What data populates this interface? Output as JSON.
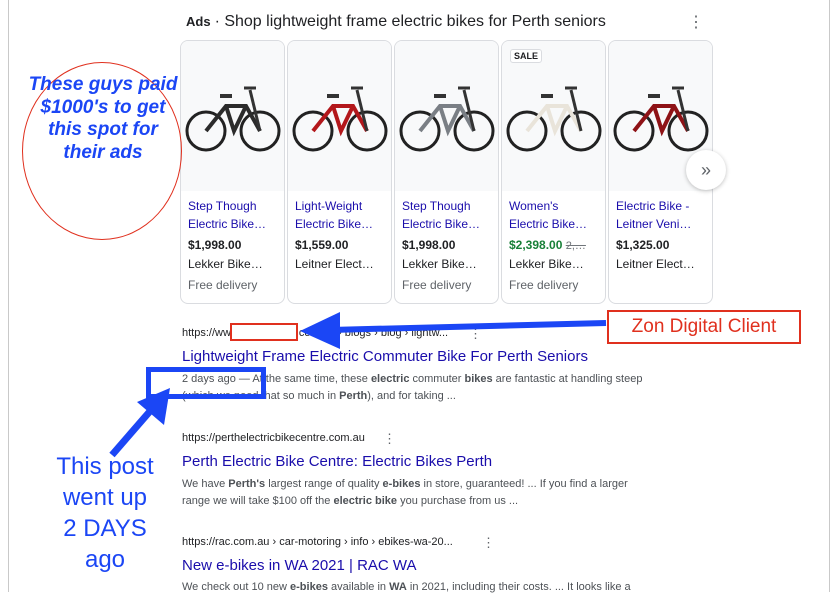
{
  "ads": {
    "label": "Ads",
    "heading": "· Shop lightweight frame electric bikes for Perth seniors",
    "products": [
      {
        "title1": "Step Though",
        "title2": "Electric Bike…",
        "price": "$1,998.00",
        "old_price": "",
        "merchant": "Lekker Bike…",
        "delivery": "Free delivery",
        "badge": "",
        "frame_color": "#2b2b2b"
      },
      {
        "title1": "Light-Weight",
        "title2": "Electric Bike…",
        "price": "$1,559.00",
        "old_price": "",
        "merchant": "Leitner Elect…",
        "delivery": "",
        "badge": "",
        "frame_color": "#b3171b"
      },
      {
        "title1": "Step Though",
        "title2": "Electric Bike…",
        "price": "$1,998.00",
        "old_price": "",
        "merchant": "Lekker Bike…",
        "delivery": "Free delivery",
        "badge": "",
        "frame_color": "#7a7f85"
      },
      {
        "title1": "Women's",
        "title2": "Electric Bike…",
        "price": "$2,398.00",
        "old_price": "2,…",
        "merchant": "Lekker Bike…",
        "delivery": "Free delivery",
        "badge": "SALE",
        "frame_color": "#e9e4da"
      },
      {
        "title1": "Electric Bike -",
        "title2": "Leitner Veni…",
        "price": "$1,325.00",
        "old_price": "",
        "merchant": "Leitner Elect…",
        "delivery": "",
        "badge": "",
        "frame_color": "#8e1216"
      }
    ],
    "next_glyph": "»"
  },
  "results": [
    {
      "url_prefix": "https://ww",
      "url_suffix": "com.au › blogs › blog › lightw...",
      "title": "Lightweight Frame Electric Commuter Bike For Perth Seniors",
      "line1": "2 days ago — At the same time, these electric commuter bikes are fantastic at handling steep",
      "line2": "(which we need that so much in Perth), and for taking ..."
    },
    {
      "url_prefix": "https://perthelectricbikecentre.com.au",
      "url_suffix": "",
      "title": "Perth Electric Bike Centre: Electric Bikes Perth",
      "line1": "We have Perth's largest range of quality e-bikes in store, guaranteed! ... If you find a larger",
      "line2": "range we will take $100 off the electric bike you purchase from us ..."
    },
    {
      "url_prefix": "https://rac.com.au › car-motoring › info › ebikes-wa-20...",
      "url_suffix": "",
      "title": "New e-bikes in WA 2021 | RAC WA",
      "line1": "We check out 10 new e-bikes available in WA in 2021, including their costs. ... It looks like a",
      "line2": ""
    }
  ],
  "kebab_glyph": "⋮",
  "annotations": {
    "oval_text": "These guys paid $1000's to get this spot for their ads",
    "client_label": "Zon Digital Client",
    "post_line1": "This post",
    "post_line2": "went up",
    "post_line3": "2 DAYS",
    "post_line4": "ago",
    "accent_blue": "#1b46f5",
    "accent_red": "#e0301e"
  }
}
